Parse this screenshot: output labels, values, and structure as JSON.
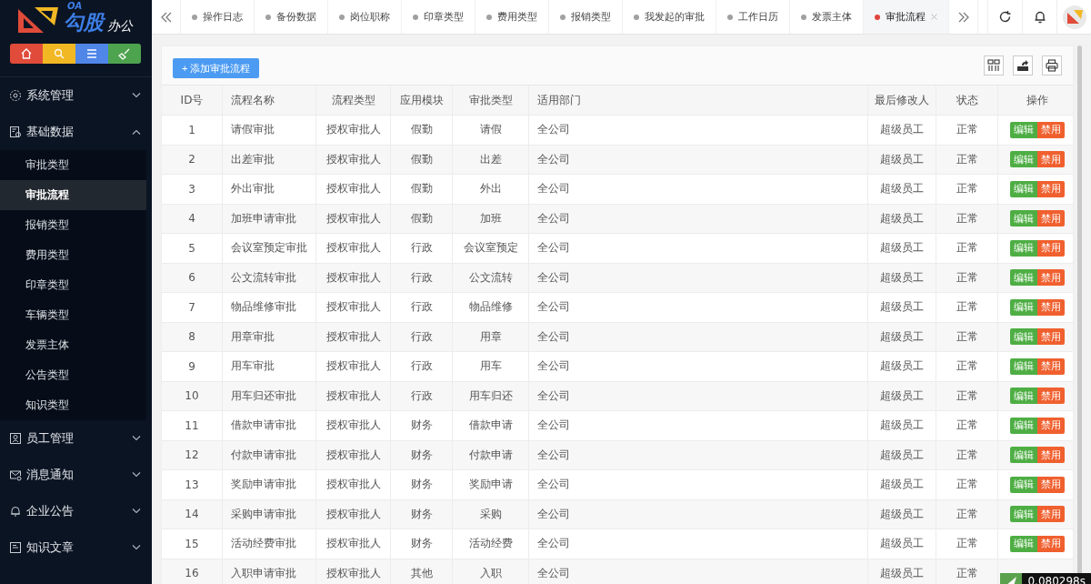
{
  "logo": {
    "badge": "OA",
    "name": "勾股",
    "suffix": "办公"
  },
  "quick_buttons": [
    {
      "color": "#e04b3a"
    },
    {
      "color": "#f2b824"
    },
    {
      "color": "#4f86e8"
    },
    {
      "color": "#4ea34f"
    }
  ],
  "sidebar": {
    "menu": [
      {
        "label": "系统管理",
        "expanded": false
      },
      {
        "label": "基础数据",
        "expanded": true,
        "children": [
          {
            "label": "审批类型",
            "selected": false
          },
          {
            "label": "审批流程",
            "selected": true
          },
          {
            "label": "报销类型",
            "selected": false
          },
          {
            "label": "费用类型",
            "selected": false
          },
          {
            "label": "印章类型",
            "selected": false
          },
          {
            "label": "车辆类型",
            "selected": false
          },
          {
            "label": "发票主体",
            "selected": false
          },
          {
            "label": "公告类型",
            "selected": false
          },
          {
            "label": "知识类型",
            "selected": false
          }
        ]
      },
      {
        "label": "员工管理",
        "expanded": false
      },
      {
        "label": "消息通知",
        "expanded": false
      },
      {
        "label": "企业公告",
        "expanded": false
      },
      {
        "label": "知识文章",
        "expanded": false
      }
    ]
  },
  "tabs": [
    {
      "label": "操作日志",
      "selected": false
    },
    {
      "label": "备份数据",
      "selected": false
    },
    {
      "label": "岗位职称",
      "selected": false
    },
    {
      "label": "印章类型",
      "selected": false
    },
    {
      "label": "费用类型",
      "selected": false
    },
    {
      "label": "报销类型",
      "selected": false
    },
    {
      "label": "我发起的审批",
      "selected": false
    },
    {
      "label": "工作日历",
      "selected": false
    },
    {
      "label": "发票主体",
      "selected": false
    },
    {
      "label": "审批流程",
      "selected": true
    }
  ],
  "toolbar": {
    "add_button": "+ 添加审批流程"
  },
  "table": {
    "columns": [
      "ID号",
      "流程名称",
      "流程类型",
      "应用模块",
      "审批类型",
      "适用部门",
      "最后修改人",
      "状态",
      "操作"
    ],
    "rows": [
      {
        "cells": [
          "1",
          "请假审批",
          "授权审批人",
          "假勤",
          "请假",
          "全公司",
          "超级员工",
          "正常"
        ],
        "actions": [
          "编辑",
          "禁用"
        ]
      },
      {
        "cells": [
          "2",
          "出差审批",
          "授权审批人",
          "假勤",
          "出差",
          "全公司",
          "超级员工",
          "正常"
        ],
        "actions": [
          "编辑",
          "禁用"
        ]
      },
      {
        "cells": [
          "3",
          "外出审批",
          "授权审批人",
          "假勤",
          "外出",
          "全公司",
          "超级员工",
          "正常"
        ],
        "actions": [
          "编辑",
          "禁用"
        ]
      },
      {
        "cells": [
          "4",
          "加班申请审批",
          "授权审批人",
          "假勤",
          "加班",
          "全公司",
          "超级员工",
          "正常"
        ],
        "actions": [
          "编辑",
          "禁用"
        ]
      },
      {
        "cells": [
          "5",
          "会议室预定审批",
          "授权审批人",
          "行政",
          "会议室预定",
          "全公司",
          "超级员工",
          "正常"
        ],
        "actions": [
          "编辑",
          "禁用"
        ]
      },
      {
        "cells": [
          "6",
          "公文流转审批",
          "授权审批人",
          "行政",
          "公文流转",
          "全公司",
          "超级员工",
          "正常"
        ],
        "actions": [
          "编辑",
          "禁用"
        ]
      },
      {
        "cells": [
          "7",
          "物品维修审批",
          "授权审批人",
          "行政",
          "物品维修",
          "全公司",
          "超级员工",
          "正常"
        ],
        "actions": [
          "编辑",
          "禁用"
        ]
      },
      {
        "cells": [
          "8",
          "用章审批",
          "授权审批人",
          "行政",
          "用章",
          "全公司",
          "超级员工",
          "正常"
        ],
        "actions": [
          "编辑",
          "禁用"
        ]
      },
      {
        "cells": [
          "9",
          "用车审批",
          "授权审批人",
          "行政",
          "用车",
          "全公司",
          "超级员工",
          "正常"
        ],
        "actions": [
          "编辑",
          "禁用"
        ]
      },
      {
        "cells": [
          "10",
          "用车归还审批",
          "授权审批人",
          "行政",
          "用车归还",
          "全公司",
          "超级员工",
          "正常"
        ],
        "actions": [
          "编辑",
          "禁用"
        ]
      },
      {
        "cells": [
          "11",
          "借款申请审批",
          "授权审批人",
          "财务",
          "借款申请",
          "全公司",
          "超级员工",
          "正常"
        ],
        "actions": [
          "编辑",
          "禁用"
        ]
      },
      {
        "cells": [
          "12",
          "付款申请审批",
          "授权审批人",
          "财务",
          "付款申请",
          "全公司",
          "超级员工",
          "正常"
        ],
        "actions": [
          "编辑",
          "禁用"
        ]
      },
      {
        "cells": [
          "13",
          "奖励申请审批",
          "授权审批人",
          "财务",
          "奖励申请",
          "全公司",
          "超级员工",
          "正常"
        ],
        "actions": [
          "编辑",
          "禁用"
        ]
      },
      {
        "cells": [
          "14",
          "采购申请审批",
          "授权审批人",
          "财务",
          "采购",
          "全公司",
          "超级员工",
          "正常"
        ],
        "actions": [
          "编辑",
          "禁用"
        ]
      },
      {
        "cells": [
          "15",
          "活动经费审批",
          "授权审批人",
          "财务",
          "活动经费",
          "全公司",
          "超级员工",
          "正常"
        ],
        "actions": [
          "编辑",
          "禁用"
        ]
      },
      {
        "cells": [
          "16",
          "入职申请审批",
          "授权审批人",
          "其他",
          "入职",
          "全公司",
          "超级员工",
          "正常"
        ]
      }
    ]
  },
  "trace": {
    "time": "0.080298s"
  }
}
